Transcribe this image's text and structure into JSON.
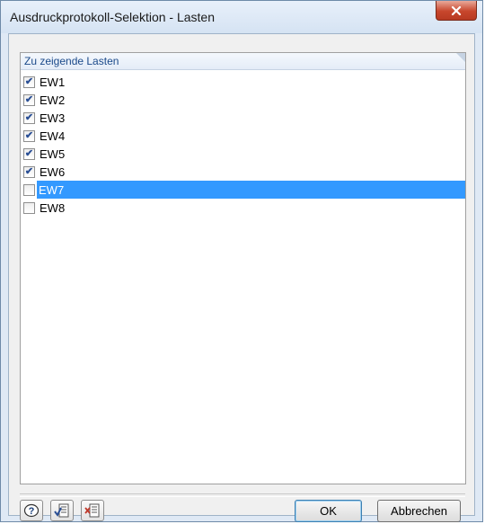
{
  "window": {
    "title": "Ausdruckprotokoll-Selektion - Lasten",
    "close_glyph": "x"
  },
  "list": {
    "header": "Zu zeigende Lasten",
    "items": [
      {
        "label": "EW1",
        "checked": true,
        "selected": false
      },
      {
        "label": "EW2",
        "checked": true,
        "selected": false
      },
      {
        "label": "EW3",
        "checked": true,
        "selected": false
      },
      {
        "label": "EW4",
        "checked": true,
        "selected": false
      },
      {
        "label": "EW5",
        "checked": true,
        "selected": false
      },
      {
        "label": "EW6",
        "checked": true,
        "selected": false
      },
      {
        "label": "EW7",
        "checked": false,
        "selected": true
      },
      {
        "label": "EW8",
        "checked": false,
        "selected": false
      }
    ]
  },
  "toolbar": {
    "help_icon": "help-icon",
    "select_all_icon": "select-all-icon",
    "deselect_all_icon": "deselect-all-icon"
  },
  "buttons": {
    "ok": "OK",
    "cancel": "Abbrechen"
  },
  "colors": {
    "selection": "#3399ff",
    "close_button": "#c7462c",
    "header_text": "#1b4a8a"
  }
}
